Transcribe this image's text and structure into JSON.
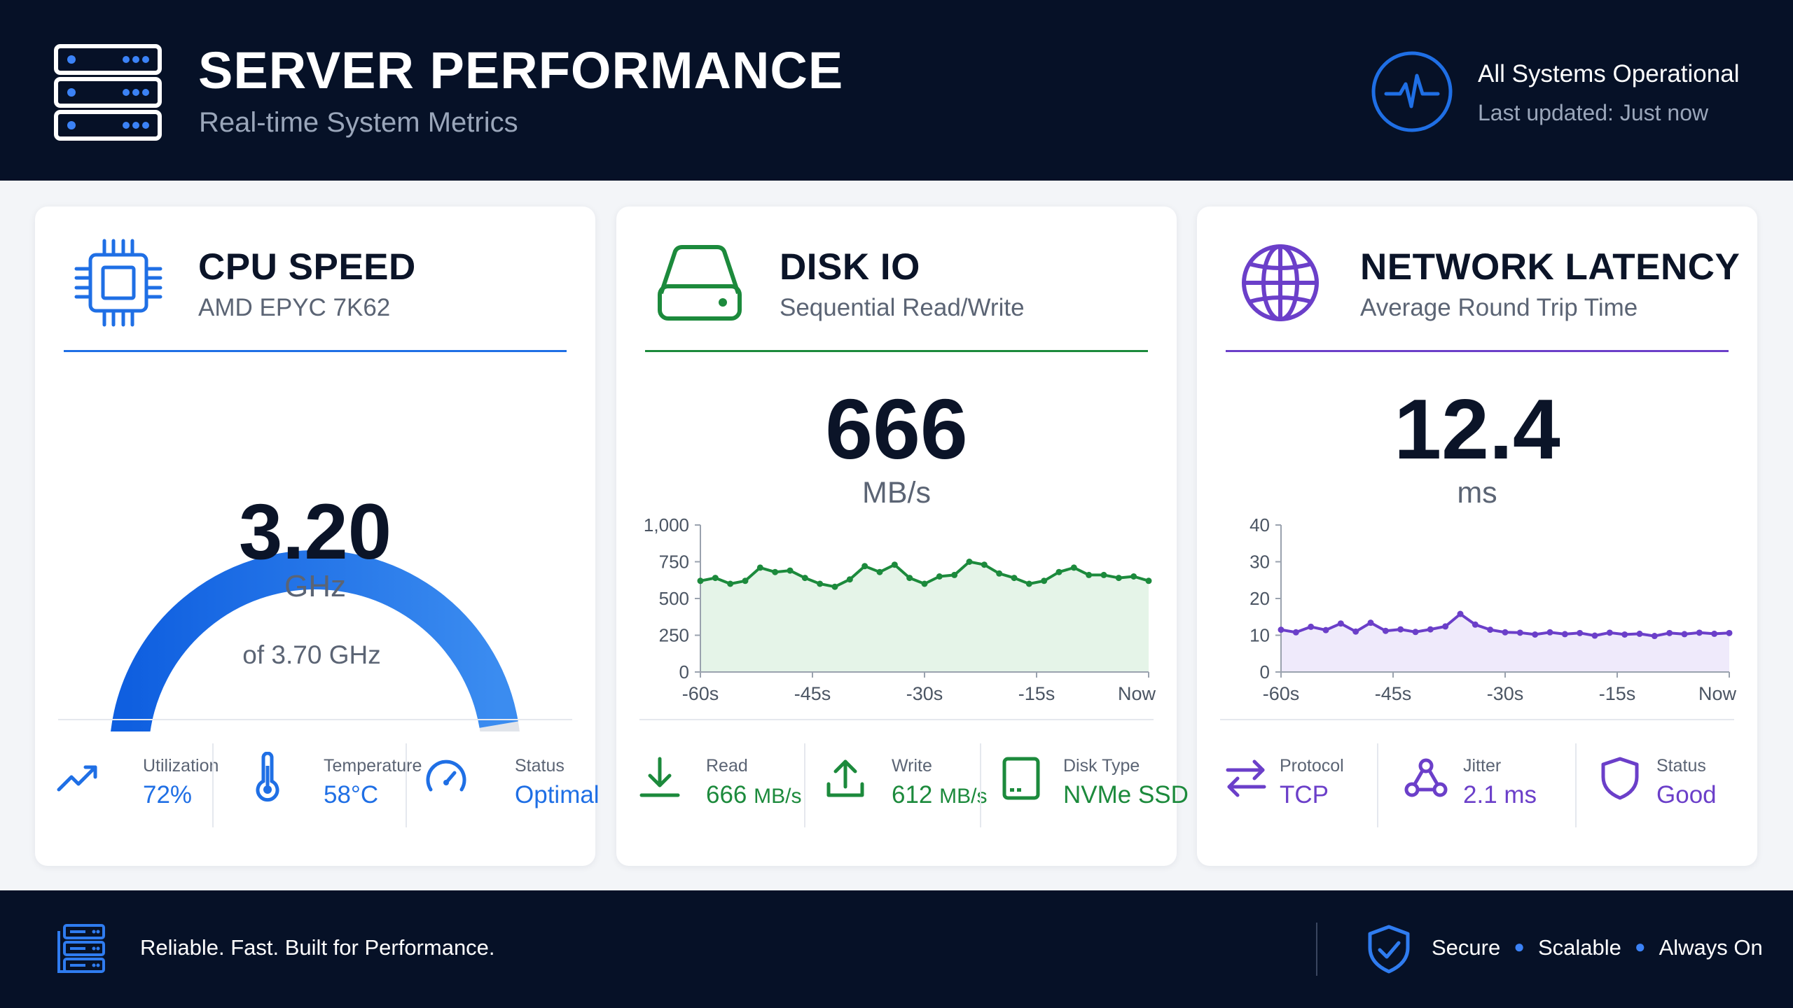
{
  "header": {
    "title": "SERVER PERFORMANCE",
    "subtitle": "Real-time System Metrics",
    "status_title": "All Systems Operational",
    "status_updated": "Last updated: Just now"
  },
  "cpu": {
    "title": "CPU SPEED",
    "subtitle": "AMD EPYC 7K62",
    "accent": "#1f6fe5",
    "value": "3.20",
    "unit": "GHz",
    "max_text": "of 3.70 GHz",
    "fraction": 0.865,
    "stats": [
      {
        "icon": "trend-up-icon",
        "label": "Utilization",
        "value": "72%"
      },
      {
        "icon": "thermometer-icon",
        "label": "Temperature",
        "value": "58°C"
      },
      {
        "icon": "speedometer-icon",
        "label": "Status",
        "value": "Optimal"
      }
    ]
  },
  "disk": {
    "title": "DISK IO",
    "subtitle": "Sequential Read/Write",
    "accent": "#1c8a3c",
    "value": "666",
    "unit": "MB/s",
    "stats": [
      {
        "icon": "download-icon",
        "label": "Read",
        "value": "666",
        "unit": "MB/s"
      },
      {
        "icon": "upload-icon",
        "label": "Write",
        "value": "612",
        "unit": "MB/s"
      },
      {
        "icon": "ssd-icon",
        "label": "Disk Type",
        "value": "NVMe SSD",
        "unit": ""
      }
    ]
  },
  "network": {
    "title": "NETWORK LATENCY",
    "subtitle": "Average Round Trip Time",
    "accent": "#6b3fc9",
    "value": "12.4",
    "unit": "ms",
    "stats": [
      {
        "icon": "swap-arrows-icon",
        "label": "Protocol",
        "value": "TCP"
      },
      {
        "icon": "nodes-icon",
        "label": "Jitter",
        "value": "2.1 ms"
      },
      {
        "icon": "shield-outline-icon",
        "label": "Status",
        "value": "Good"
      }
    ]
  },
  "chart_data": [
    {
      "type": "area",
      "x": [
        -60,
        -58,
        -56,
        -54,
        -52,
        -50,
        -48,
        -46,
        -44,
        -42,
        -40,
        -38,
        -36,
        -34,
        -32,
        -30,
        -28,
        -26,
        -24,
        -22,
        -20,
        -18,
        -16,
        -14,
        -12,
        -10,
        -8,
        -6,
        -4,
        -2,
        0
      ],
      "series": [
        {
          "values": [
            620,
            640,
            600,
            620,
            710,
            680,
            690,
            640,
            600,
            580,
            630,
            720,
            680,
            730,
            640,
            600,
            650,
            660,
            750,
            730,
            670,
            640,
            600,
            620,
            680,
            710,
            660,
            660,
            640,
            650,
            620
          ]
        }
      ],
      "ylim": [
        0,
        1000
      ],
      "yticks": [
        "0",
        "250",
        "500",
        "750",
        "1,000"
      ],
      "xticks": [
        "-60s",
        "-45s",
        "-30s",
        "-15s",
        "Now"
      ],
      "color": "#1c8a3c",
      "fill": "#e5f4e8"
    },
    {
      "type": "area",
      "x": [
        -60,
        -58,
        -56,
        -54,
        -52,
        -50,
        -48,
        -46,
        -44,
        -42,
        -40,
        -38,
        -36,
        -34,
        -32,
        -30,
        -28,
        -26,
        -24,
        -22,
        -20,
        -18,
        -16,
        -14,
        -12,
        -10,
        -8,
        -6,
        -4,
        -2,
        0
      ],
      "series": [
        {
          "values": [
            11.5,
            10.8,
            12.3,
            11.4,
            13.2,
            11.0,
            13.4,
            11.2,
            11.6,
            10.9,
            11.6,
            12.4,
            15.8,
            12.9,
            11.5,
            10.8,
            10.7,
            10.2,
            10.8,
            10.3,
            10.6,
            9.9,
            10.7,
            10.2,
            10.4,
            9.8,
            10.6,
            10.3,
            10.7,
            10.4,
            10.6
          ]
        }
      ],
      "ylim": [
        0,
        40
      ],
      "yticks": [
        "0",
        "10",
        "20",
        "30",
        "40"
      ],
      "xticks": [
        "-60s",
        "-45s",
        "-30s",
        "-15s",
        "Now"
      ],
      "color": "#6b3fc9",
      "fill": "#efeafb"
    }
  ],
  "footer": {
    "tagline": "Reliable. Fast. Built for Performance.",
    "badges": [
      "Secure",
      "Scalable",
      "Always On"
    ]
  },
  "colors": {
    "navy": "#061127",
    "blue": "#1f6fe5",
    "green": "#1c8a3c",
    "purple": "#6b3fc9"
  }
}
